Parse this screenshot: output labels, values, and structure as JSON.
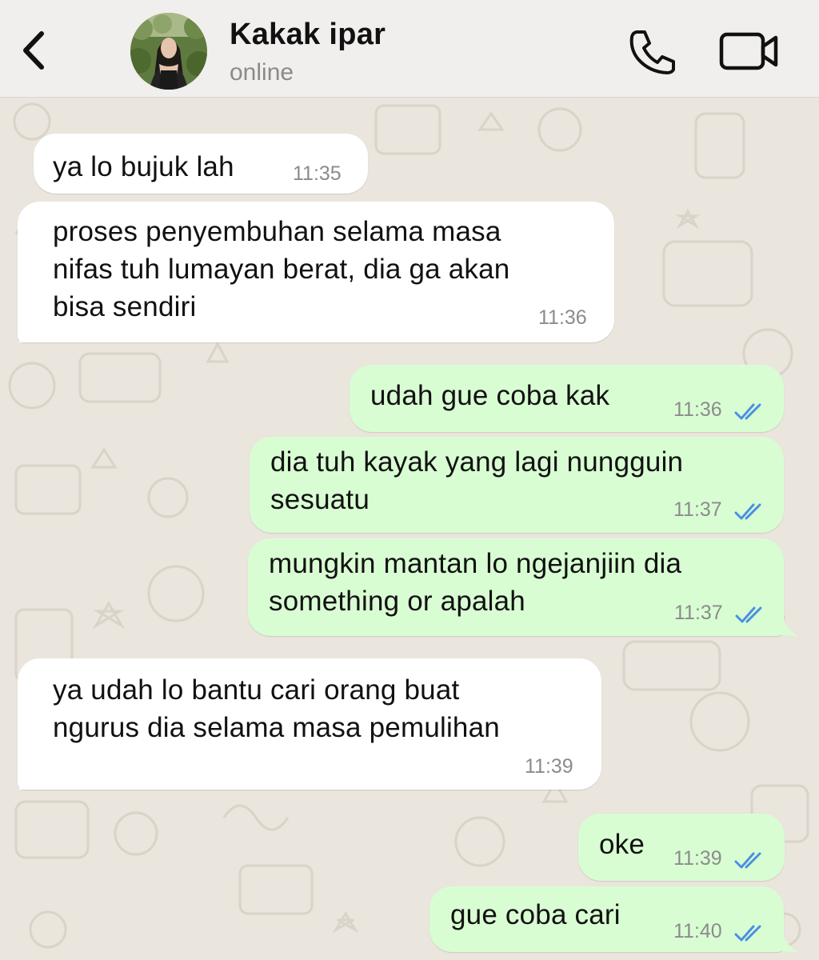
{
  "colors": {
    "header_bg": "#f0efee",
    "chat_bg": "#eae5dd",
    "incoming_bubble": "#ffffff",
    "outgoing_bubble": "#d9fdd3",
    "read_tick": "#4a90e2"
  },
  "header": {
    "back_icon": "chevron-left-icon",
    "contact_name": "Kakak ipar",
    "contact_status": "online",
    "call_icon": "phone-icon",
    "video_icon": "video-camera-icon"
  },
  "messages": [
    {
      "direction": "incoming",
      "lines": [
        "ya lo bujuk lah"
      ],
      "time": "11:35"
    },
    {
      "direction": "incoming",
      "lines": [
        "proses penyembuhan selama masa",
        "nifas tuh lumayan berat, dia ga akan",
        "bisa sendiri"
      ],
      "time": "11:36"
    },
    {
      "direction": "outgoing",
      "lines": [
        "udah gue coba kak"
      ],
      "time": "11:36",
      "status": "read"
    },
    {
      "direction": "outgoing",
      "lines": [
        "dia tuh kayak yang lagi nungguin",
        "sesuatu"
      ],
      "time": "11:37",
      "status": "read"
    },
    {
      "direction": "outgoing",
      "lines": [
        "mungkin mantan lo ngejanjiin dia",
        "something or apalah"
      ],
      "time": "11:37",
      "status": "read"
    },
    {
      "direction": "incoming",
      "lines": [
        "ya udah lo bantu cari orang buat",
        "ngurus dia selama masa pemulihan"
      ],
      "time": "11:39"
    },
    {
      "direction": "outgoing",
      "lines": [
        "oke"
      ],
      "time": "11:39",
      "status": "read"
    },
    {
      "direction": "outgoing",
      "lines": [
        "gue coba cari"
      ],
      "time": "11:40",
      "status": "read"
    }
  ]
}
